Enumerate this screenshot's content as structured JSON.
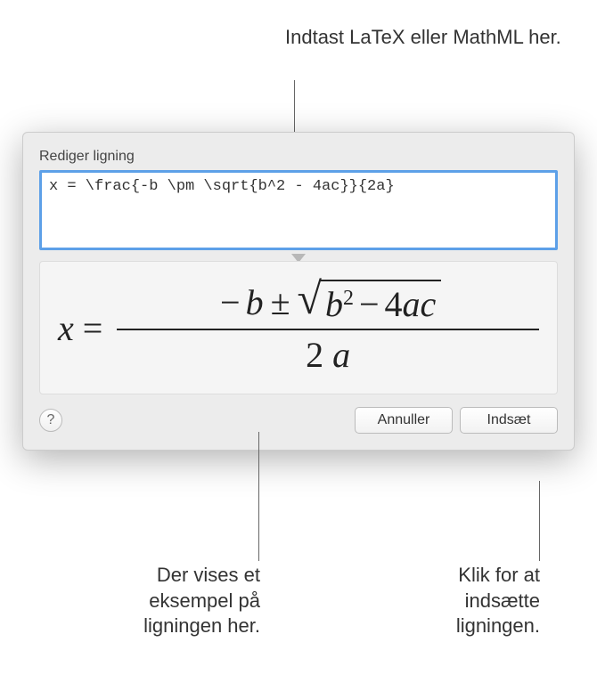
{
  "callouts": {
    "top": "Indtast LaTeX eller MathML her.",
    "bottom_left": "Der vises et eksempel på ligningen her.",
    "bottom_right": "Klik for at indsætte ligningen."
  },
  "dialog": {
    "title": "Rediger ligning",
    "input_value": "x = \\frac{-b \\pm \\sqrt{b^2 - 4ac}}{2a}",
    "help_label": "?",
    "cancel_label": "Annuller",
    "insert_label": "Indsæt"
  },
  "formula": {
    "lhs": "x",
    "eq": "=",
    "neg": "−",
    "b": "b",
    "pm": "±",
    "b2": "b",
    "exp": "2",
    "minus": "−",
    "four": "4",
    "a": "a",
    "c": "c",
    "den_two": "2",
    "den_a": "a"
  }
}
